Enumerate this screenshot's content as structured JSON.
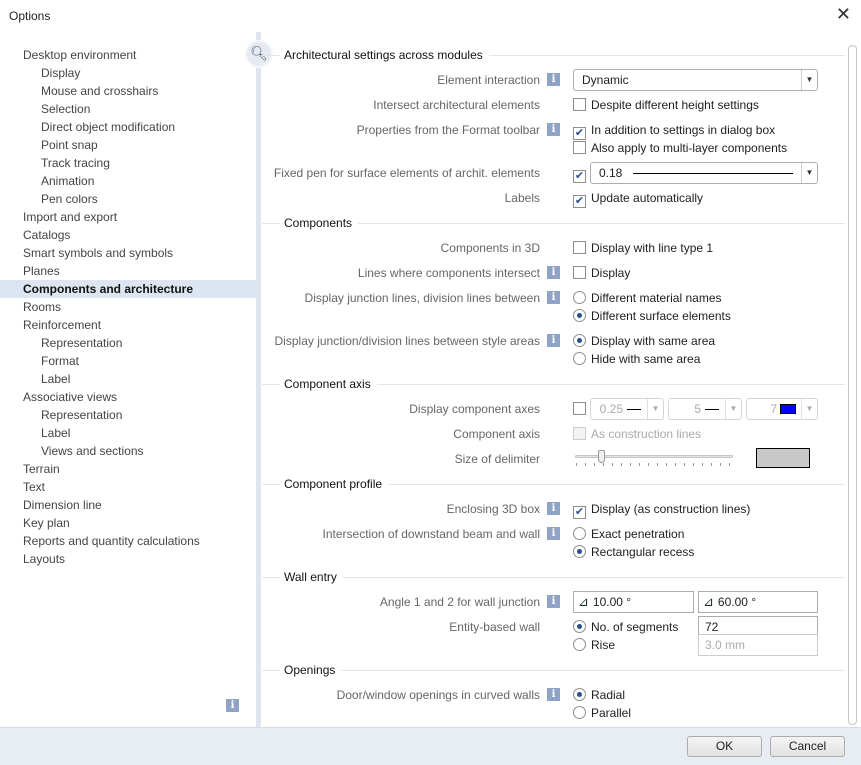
{
  "window": {
    "title": "Options",
    "close_icon": "close-icon"
  },
  "nav": {
    "items": [
      {
        "label": "Desktop environment",
        "level": 0
      },
      {
        "label": "Display",
        "level": 1
      },
      {
        "label": "Mouse and crosshairs",
        "level": 1
      },
      {
        "label": "Selection",
        "level": 1
      },
      {
        "label": "Direct object modification",
        "level": 1
      },
      {
        "label": "Point snap",
        "level": 1
      },
      {
        "label": "Track tracing",
        "level": 1
      },
      {
        "label": "Animation",
        "level": 1
      },
      {
        "label": "Pen colors",
        "level": 1
      },
      {
        "label": "Import and export",
        "level": 0
      },
      {
        "label": "Catalogs",
        "level": 0
      },
      {
        "label": "Smart symbols and symbols",
        "level": 0
      },
      {
        "label": "Planes",
        "level": 0
      },
      {
        "label": "Components and architecture",
        "level": 0,
        "selected": true
      },
      {
        "label": "Rooms",
        "level": 0
      },
      {
        "label": "Reinforcement",
        "level": 0
      },
      {
        "label": "Representation",
        "level": 1
      },
      {
        "label": "Format",
        "level": 1
      },
      {
        "label": "Label",
        "level": 1
      },
      {
        "label": "Associative views",
        "level": 0
      },
      {
        "label": "Representation",
        "level": 1
      },
      {
        "label": "Label",
        "level": 1
      },
      {
        "label": "Views and sections",
        "level": 1
      },
      {
        "label": "Terrain",
        "level": 0
      },
      {
        "label": "Text",
        "level": 0
      },
      {
        "label": "Dimension line",
        "level": 0
      },
      {
        "label": "Key plan",
        "level": 0
      },
      {
        "label": "Reports and quantity calculations",
        "level": 0
      },
      {
        "label": "Layouts",
        "level": 0
      }
    ]
  },
  "info_glyph": "i",
  "sections": [
    {
      "title": "Architectural settings across modules",
      "rows": [
        {
          "label": "Element interaction",
          "info": true,
          "lines": [
            {
              "type": "select",
              "value": "Dynamic"
            }
          ]
        },
        {
          "label": "Intersect architectural elements",
          "lines": [
            {
              "type": "checkbox",
              "checked": false,
              "label": "Despite different height settings"
            }
          ]
        },
        {
          "label": "Properties from the Format toolbar",
          "info": true,
          "lines": [
            {
              "type": "checkbox",
              "checked": true,
              "label": "In addition to settings in dialog box"
            },
            {
              "type": "checkbox",
              "checked": false,
              "label": "Also apply to multi-layer components"
            }
          ]
        },
        {
          "label": "Fixed pen for surface elements of archit. elements",
          "lines": [
            {
              "type": "pen",
              "checked": true,
              "value": "0.18"
            }
          ]
        },
        {
          "label": "Labels",
          "lines": [
            {
              "type": "checkbox",
              "checked": true,
              "label": "Update automatically"
            }
          ]
        }
      ]
    },
    {
      "title": "Components",
      "rows": [
        {
          "label": "Components in 3D",
          "lines": [
            {
              "type": "checkbox",
              "checked": false,
              "label": "Display with line type 1"
            }
          ]
        },
        {
          "label": "Lines where components intersect",
          "info": true,
          "lines": [
            {
              "type": "checkbox",
              "checked": false,
              "label": "Display"
            }
          ]
        },
        {
          "label": "Display junction lines, division lines between",
          "info": true,
          "lines": [
            {
              "type": "radio",
              "checked": false,
              "label": "Different material names"
            },
            {
              "type": "radio",
              "checked": true,
              "label": "Different surface elements"
            }
          ]
        },
        {
          "label": "Display junction/division lines between style areas",
          "info": true,
          "lines": [
            {
              "type": "radio",
              "checked": true,
              "label": "Display with same area"
            },
            {
              "type": "radio",
              "checked": false,
              "label": "Hide with same area"
            }
          ]
        }
      ]
    },
    {
      "title": "Component axis",
      "rows": [
        {
          "label": "Display component axes",
          "lines": [
            {
              "type": "combos",
              "checked": false,
              "items": [
                {
                  "value": "0.25"
                },
                {
                  "value": "5"
                },
                {
                  "value": "7",
                  "color": "#0000ff"
                }
              ]
            }
          ]
        },
        {
          "label": "Component axis",
          "lines": [
            {
              "type": "checkbox",
              "checked": false,
              "disabled": true,
              "label": "As construction lines"
            }
          ]
        },
        {
          "label": "Size of delimiter",
          "lines": [
            {
              "type": "slider",
              "value": 0.17,
              "preview_color": "#c8c8c8"
            }
          ]
        }
      ]
    },
    {
      "title": "Component profile",
      "rows": [
        {
          "label": "Enclosing 3D box",
          "info": true,
          "lines": [
            {
              "type": "checkbox",
              "checked": true,
              "label": "Display (as construction lines)"
            }
          ]
        },
        {
          "label": "Intersection of downstand beam and wall",
          "info": true,
          "lines": [
            {
              "type": "radio",
              "checked": false,
              "label": "Exact penetration"
            },
            {
              "type": "radio",
              "checked": true,
              "label": "Rectangular recess"
            }
          ]
        }
      ]
    },
    {
      "title": "Wall entry",
      "rows": [
        {
          "label": "Angle 1 and 2 for wall junction",
          "info": true,
          "lines": [
            {
              "type": "angles",
              "values": [
                "10.00 °",
                "60.00 °"
              ]
            }
          ]
        },
        {
          "label": "Entity-based wall",
          "lines": [
            {
              "type": "radio-input",
              "checked": true,
              "label": "No. of segments",
              "input": "72"
            },
            {
              "type": "radio-input",
              "checked": false,
              "label": "Rise",
              "input": "3.0 mm",
              "disabled": true
            }
          ]
        }
      ]
    },
    {
      "title": "Openings",
      "rows": [
        {
          "label": "Door/window openings in curved walls",
          "info": true,
          "lines": [
            {
              "type": "radio",
              "checked": true,
              "label": "Radial"
            },
            {
              "type": "radio",
              "checked": false,
              "label": "Parallel"
            }
          ]
        }
      ]
    }
  ],
  "footer": {
    "ok": "OK",
    "cancel": "Cancel"
  }
}
